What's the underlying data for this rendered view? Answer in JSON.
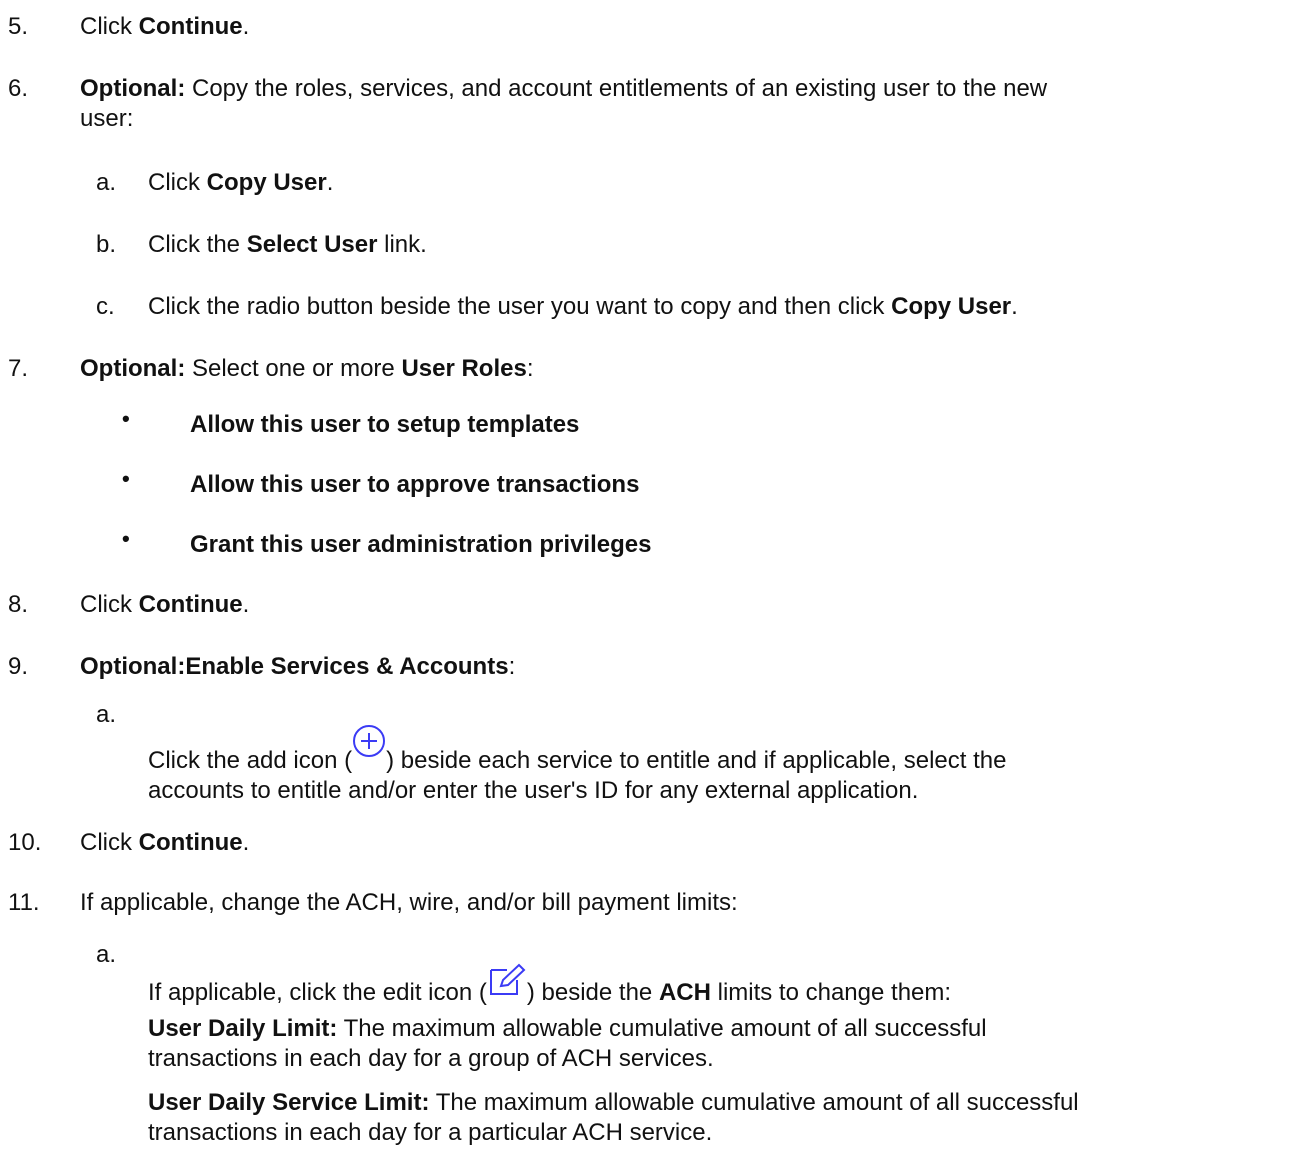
{
  "steps": {
    "s5": {
      "num": "5.",
      "pre": "Click ",
      "bold": "Continue",
      "post": "."
    },
    "s6": {
      "num": "6.",
      "bold": "Optional:",
      "rest_line1": " Copy the roles, services, and account entitlements of an existing user to the new",
      "rest_line2": "user:"
    },
    "s6a": {
      "num": "a.",
      "pre": "Click ",
      "bold": "Copy User",
      "post": "."
    },
    "s6b": {
      "num": "b.",
      "pre": "Click the ",
      "bold": "Select User",
      "post": " link."
    },
    "s6c": {
      "num": "c.",
      "pre": "Click the radio button beside the user you want to copy and then click ",
      "bold": "Copy User",
      "post": "."
    },
    "s7": {
      "num": "7.",
      "bold": "Optional:",
      "pre": " Select one or more ",
      "bold2": "User Roles",
      "post": ":"
    },
    "roles": [
      "Allow this user to setup templates",
      "Allow this user to approve transactions",
      "Grant this user administration privileges"
    ],
    "bullet": "•",
    "s8": {
      "num": "8.",
      "pre": "Click ",
      "bold": "Continue",
      "post": "."
    },
    "s9": {
      "num": "9.",
      "bold": "Optional:Enable Services & Accounts",
      "post": ":"
    },
    "s9a": {
      "num": "a.",
      "pre": "Click the add icon (",
      "post": ") beside each service to entitle and if applicable, select the",
      "line2": "accounts to entitle and/or enter the user's ID for any external application."
    },
    "s10": {
      "num": "10.",
      "pre": "Click ",
      "bold": "Continue",
      "post": "."
    },
    "s11": {
      "num": "11.",
      "text": "If applicable, change the ACH, wire, and/or bill payment limits:"
    },
    "s11a": {
      "num": "a.",
      "pre": "If applicable, click the edit icon (",
      "mid": ") beside the ",
      "bold": "ACH",
      "post": "  limits to change them:"
    },
    "def1": {
      "term": "User Daily Limit:",
      "line1": "  The maximum allowable cumulative amount of all successful",
      "line2": "transactions in each day for a group of ACH services."
    },
    "def2": {
      "term": "User Daily Service Limit:",
      "line1": " The maximum allowable cumulative amount of all successful",
      "line2": "transactions in each day for a particular ACH service."
    }
  },
  "icons": {
    "add": "add-circle-icon",
    "edit": "edit-square-icon",
    "color": "#3b3bf5"
  }
}
